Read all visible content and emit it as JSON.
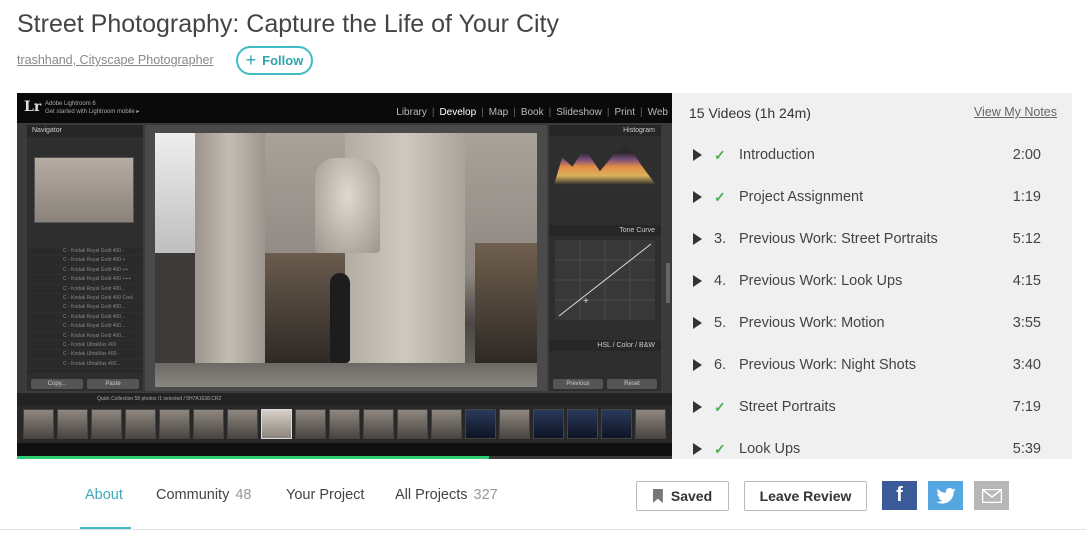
{
  "course": {
    "title": "Street Photography: Capture the Life of Your City",
    "author": "trashhand, Cityscape Photographer",
    "follow_label": "Follow"
  },
  "player": {
    "app_logo": "Lr",
    "app_subtitle_line1": "Adobe Lightroom 6",
    "app_subtitle_line2": "Get started with Lightroom mobile ▸",
    "modules": [
      "Library",
      "Develop",
      "Map",
      "Book",
      "Slideshow",
      "Print",
      "Web"
    ],
    "active_module": "Develop",
    "navigator_label": "Navigator",
    "histogram_label": "Histogram",
    "tone_curve_label": "Tone Curve",
    "hsl_label": "HSL / Color / B&W",
    "copy_label": "Copy...",
    "paste_label": "Paste",
    "previous_label": "Previous",
    "reset_label": "Reset",
    "filmstrip_info": "Quick Collection   58 photos /1 selected / 5H7A1638.CR2",
    "presets": [
      "C - Kodak Royal Gold 400 -",
      "C - Kodak Royal Gold 400 +",
      "C - Kodak Royal Gold 400 ++",
      "C - Kodak Royal Gold 400 +++",
      "C - Kodak Royal Gold 400...",
      "C - Kodak Royal Gold 400 Cool",
      "C - Kodak Royal Gold 400...",
      "C - Kodak Royal Gold 400...",
      "C - Kodak Royal Gold 400...",
      "C - Kodak Royal Gold 400...",
      "C - Kodak UltraMax 400",
      "C - Kodak UltraMax 400 -",
      "C - Kodak UltraMax 400..."
    ],
    "progress_fraction": 0.72
  },
  "video_list": {
    "header": "15 Videos (1h 24m)",
    "notes_link": "View My Notes",
    "items": [
      {
        "num": "",
        "done": true,
        "title": "Introduction",
        "duration": "2:00"
      },
      {
        "num": "",
        "done": true,
        "title": "Project Assignment",
        "duration": "1:19"
      },
      {
        "num": "3.",
        "done": false,
        "title": "Previous Work: Street Portraits",
        "duration": "5:12"
      },
      {
        "num": "4.",
        "done": false,
        "title": "Previous Work: Look Ups",
        "duration": "4:15"
      },
      {
        "num": "5.",
        "done": false,
        "title": "Previous Work: Motion",
        "duration": "3:55"
      },
      {
        "num": "6.",
        "done": false,
        "title": "Previous Work: Night Shots",
        "duration": "3:40"
      },
      {
        "num": "",
        "done": true,
        "title": "Street Portraits",
        "duration": "7:19"
      },
      {
        "num": "",
        "done": true,
        "title": "Look Ups",
        "duration": "5:39"
      }
    ]
  },
  "tabs": {
    "about": "About",
    "community": "Community",
    "community_count": "48",
    "your_project": "Your Project",
    "all_projects": "All Projects",
    "all_projects_count": "327"
  },
  "actions": {
    "saved_label": "Saved",
    "review_label": "Leave Review"
  },
  "social": {
    "facebook_icon": "facebook-icon",
    "twitter_icon": "twitter-icon",
    "email_icon": "email-icon",
    "facebook_color": "#3b5a99",
    "twitter_color": "#56a7e1",
    "email_color": "#b7b7b7"
  },
  "colors": {
    "accent": "#45b8c6",
    "progress": "#2ecc71",
    "check": "#4caf50"
  }
}
